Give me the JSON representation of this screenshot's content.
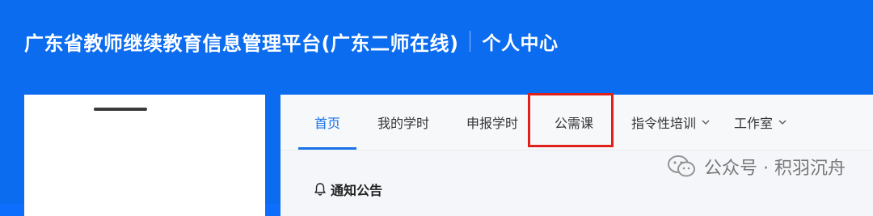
{
  "header": {
    "platform_title": "广东省教师继续教育信息管理平台(广东二师在线)",
    "section_title": "个人中心"
  },
  "nav": {
    "items": [
      {
        "label": "首页",
        "active": true
      },
      {
        "label": "我的学时",
        "active": false
      },
      {
        "label": "申报学时",
        "active": false
      },
      {
        "label": "公需课",
        "active": false,
        "highlighted": true
      },
      {
        "label": "指令性培训",
        "active": false,
        "dropdown": true
      },
      {
        "label": "工作室",
        "active": false,
        "dropdown": true
      }
    ]
  },
  "notice": {
    "title": "通知公告"
  },
  "watermark": {
    "text": "公众号 · 积羽沉舟"
  },
  "colors": {
    "header_bg": "#0b6cf0",
    "accent": "#1a73e8",
    "highlight_border": "#e0201b"
  },
  "icons": {
    "bell": "bell-icon",
    "chevron": "chevron-down-icon",
    "wechat": "wechat-icon"
  }
}
